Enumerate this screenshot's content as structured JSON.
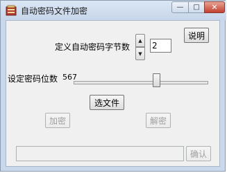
{
  "window": {
    "title": "自动密码文件加密",
    "min_glyph": "—",
    "max_glyph": "□",
    "close_glyph": "✕"
  },
  "keybytes": {
    "label": "定义自动密码字节数",
    "value": "2",
    "up_glyph": "▲",
    "down_glyph": "▼"
  },
  "help_button": "说明",
  "bits": {
    "label": "设定密码位数",
    "value": "567"
  },
  "select_file_button": "选文件",
  "encrypt_button": "加密",
  "decrypt_button": "解密",
  "path_field": {
    "value": ""
  },
  "confirm_button": "确认"
}
